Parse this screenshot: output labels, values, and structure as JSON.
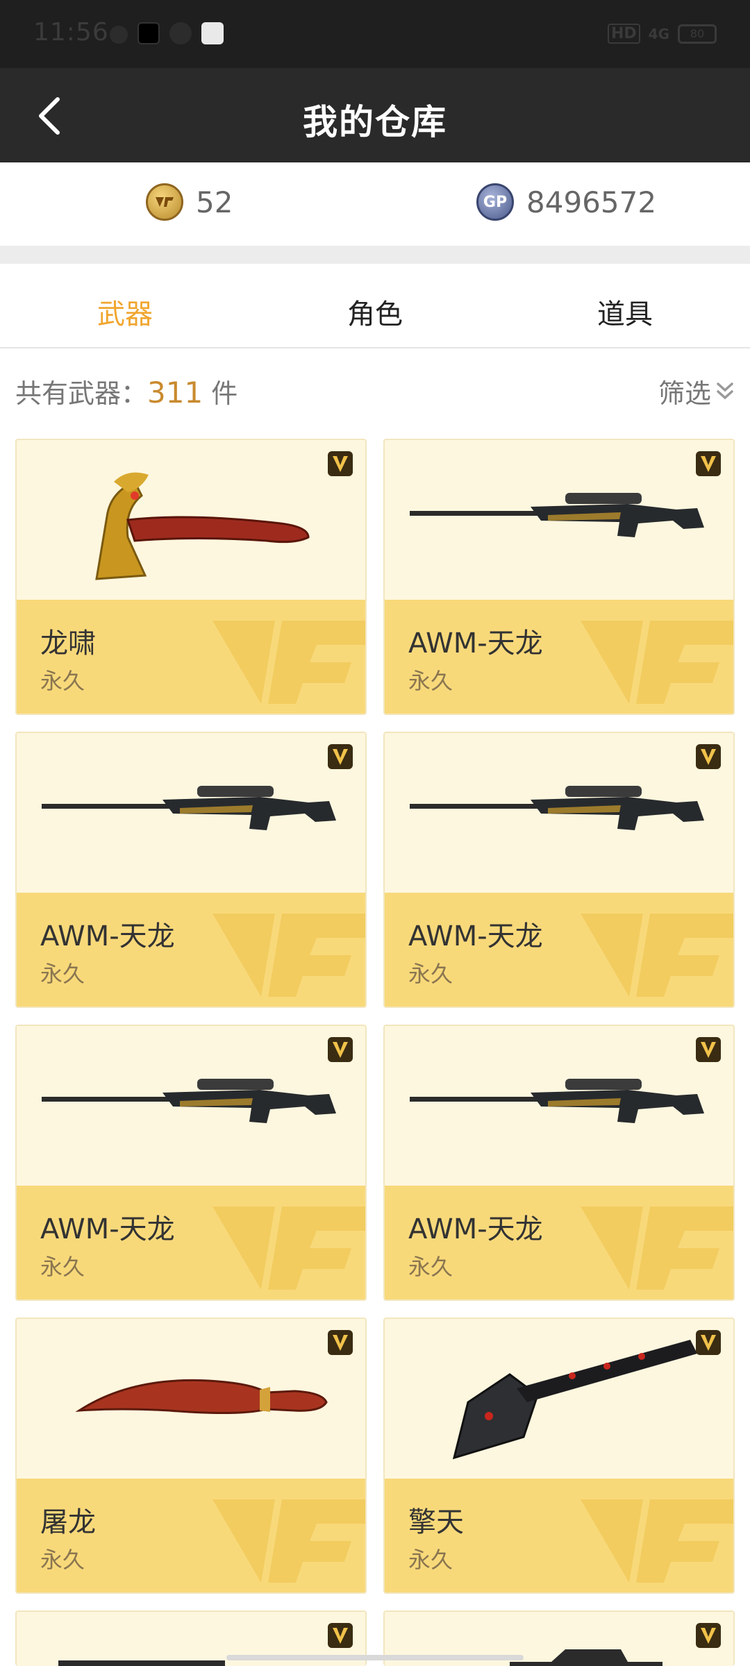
{
  "status": {
    "time": "11:56",
    "hd": "HD",
    "network": "4G",
    "battery": "80"
  },
  "nav": {
    "title": "我的仓库"
  },
  "currency": {
    "cf_value": "52",
    "gp_value": "8496572",
    "cf_icon": "cf-coin-icon",
    "gp_icon": "gp-coin-icon",
    "gp_label": "GP"
  },
  "tabs": [
    {
      "label": "武器",
      "active": true
    },
    {
      "label": "角色",
      "active": false
    },
    {
      "label": "道具",
      "active": false
    }
  ],
  "count": {
    "prefix": "共有武器：",
    "number": "311",
    "suffix": " 件",
    "filter_label": "筛选"
  },
  "colors": {
    "accent": "#f0a630",
    "card_bottom": "#f8d97a",
    "card_top": "#fef7df",
    "nav_bg": "#2a2a2a"
  },
  "items": [
    {
      "name": "龙啸",
      "duration": "永久",
      "icon": "dragon-axe-icon"
    },
    {
      "name": "AWM-天龙",
      "duration": "永久",
      "icon": "sniper-rifle-icon"
    },
    {
      "name": "AWM-天龙",
      "duration": "永久",
      "icon": "sniper-rifle-icon"
    },
    {
      "name": "AWM-天龙",
      "duration": "永久",
      "icon": "sniper-rifle-icon"
    },
    {
      "name": "AWM-天龙",
      "duration": "永久",
      "icon": "sniper-rifle-icon"
    },
    {
      "name": "AWM-天龙",
      "duration": "永久",
      "icon": "sniper-rifle-icon"
    },
    {
      "name": "屠龙",
      "duration": "永久",
      "icon": "kukri-knife-icon"
    },
    {
      "name": "擎天",
      "duration": "永久",
      "icon": "shovel-icon"
    }
  ]
}
